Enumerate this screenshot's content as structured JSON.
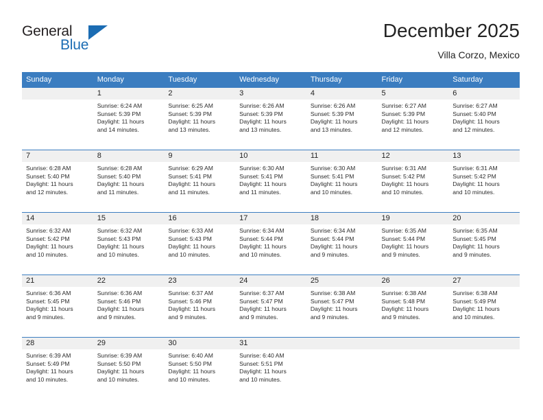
{
  "logo": {
    "line1": "General",
    "line2": "Blue",
    "triangle_icon": "triangle-icon",
    "color_primary": "#1b6cb3",
    "color_text": "#231f20"
  },
  "header": {
    "title": "December 2025",
    "subtitle": "Villa Corzo, Mexico"
  },
  "theme": {
    "header_bg": "#3b7dc0",
    "daynum_bg": "#f0f0f0",
    "text": "#232323"
  },
  "weekdays": [
    "Sunday",
    "Monday",
    "Tuesday",
    "Wednesday",
    "Thursday",
    "Friday",
    "Saturday"
  ],
  "weeks": [
    [
      {
        "day": "",
        "sunrise": "",
        "sunset": "",
        "daylight1": "",
        "daylight2": "",
        "empty": true
      },
      {
        "day": "1",
        "sunrise": "Sunrise: 6:24 AM",
        "sunset": "Sunset: 5:39 PM",
        "daylight1": "Daylight: 11 hours",
        "daylight2": "and 14 minutes."
      },
      {
        "day": "2",
        "sunrise": "Sunrise: 6:25 AM",
        "sunset": "Sunset: 5:39 PM",
        "daylight1": "Daylight: 11 hours",
        "daylight2": "and 13 minutes."
      },
      {
        "day": "3",
        "sunrise": "Sunrise: 6:26 AM",
        "sunset": "Sunset: 5:39 PM",
        "daylight1": "Daylight: 11 hours",
        "daylight2": "and 13 minutes."
      },
      {
        "day": "4",
        "sunrise": "Sunrise: 6:26 AM",
        "sunset": "Sunset: 5:39 PM",
        "daylight1": "Daylight: 11 hours",
        "daylight2": "and 13 minutes."
      },
      {
        "day": "5",
        "sunrise": "Sunrise: 6:27 AM",
        "sunset": "Sunset: 5:39 PM",
        "daylight1": "Daylight: 11 hours",
        "daylight2": "and 12 minutes."
      },
      {
        "day": "6",
        "sunrise": "Sunrise: 6:27 AM",
        "sunset": "Sunset: 5:40 PM",
        "daylight1": "Daylight: 11 hours",
        "daylight2": "and 12 minutes."
      }
    ],
    [
      {
        "day": "7",
        "sunrise": "Sunrise: 6:28 AM",
        "sunset": "Sunset: 5:40 PM",
        "daylight1": "Daylight: 11 hours",
        "daylight2": "and 12 minutes."
      },
      {
        "day": "8",
        "sunrise": "Sunrise: 6:28 AM",
        "sunset": "Sunset: 5:40 PM",
        "daylight1": "Daylight: 11 hours",
        "daylight2": "and 11 minutes."
      },
      {
        "day": "9",
        "sunrise": "Sunrise: 6:29 AM",
        "sunset": "Sunset: 5:41 PM",
        "daylight1": "Daylight: 11 hours",
        "daylight2": "and 11 minutes."
      },
      {
        "day": "10",
        "sunrise": "Sunrise: 6:30 AM",
        "sunset": "Sunset: 5:41 PM",
        "daylight1": "Daylight: 11 hours",
        "daylight2": "and 11 minutes."
      },
      {
        "day": "11",
        "sunrise": "Sunrise: 6:30 AM",
        "sunset": "Sunset: 5:41 PM",
        "daylight1": "Daylight: 11 hours",
        "daylight2": "and 10 minutes."
      },
      {
        "day": "12",
        "sunrise": "Sunrise: 6:31 AM",
        "sunset": "Sunset: 5:42 PM",
        "daylight1": "Daylight: 11 hours",
        "daylight2": "and 10 minutes."
      },
      {
        "day": "13",
        "sunrise": "Sunrise: 6:31 AM",
        "sunset": "Sunset: 5:42 PM",
        "daylight1": "Daylight: 11 hours",
        "daylight2": "and 10 minutes."
      }
    ],
    [
      {
        "day": "14",
        "sunrise": "Sunrise: 6:32 AM",
        "sunset": "Sunset: 5:42 PM",
        "daylight1": "Daylight: 11 hours",
        "daylight2": "and 10 minutes."
      },
      {
        "day": "15",
        "sunrise": "Sunrise: 6:32 AM",
        "sunset": "Sunset: 5:43 PM",
        "daylight1": "Daylight: 11 hours",
        "daylight2": "and 10 minutes."
      },
      {
        "day": "16",
        "sunrise": "Sunrise: 6:33 AM",
        "sunset": "Sunset: 5:43 PM",
        "daylight1": "Daylight: 11 hours",
        "daylight2": "and 10 minutes."
      },
      {
        "day": "17",
        "sunrise": "Sunrise: 6:34 AM",
        "sunset": "Sunset: 5:44 PM",
        "daylight1": "Daylight: 11 hours",
        "daylight2": "and 10 minutes."
      },
      {
        "day": "18",
        "sunrise": "Sunrise: 6:34 AM",
        "sunset": "Sunset: 5:44 PM",
        "daylight1": "Daylight: 11 hours",
        "daylight2": "and 9 minutes."
      },
      {
        "day": "19",
        "sunrise": "Sunrise: 6:35 AM",
        "sunset": "Sunset: 5:44 PM",
        "daylight1": "Daylight: 11 hours",
        "daylight2": "and 9 minutes."
      },
      {
        "day": "20",
        "sunrise": "Sunrise: 6:35 AM",
        "sunset": "Sunset: 5:45 PM",
        "daylight1": "Daylight: 11 hours",
        "daylight2": "and 9 minutes."
      }
    ],
    [
      {
        "day": "21",
        "sunrise": "Sunrise: 6:36 AM",
        "sunset": "Sunset: 5:45 PM",
        "daylight1": "Daylight: 11 hours",
        "daylight2": "and 9 minutes."
      },
      {
        "day": "22",
        "sunrise": "Sunrise: 6:36 AM",
        "sunset": "Sunset: 5:46 PM",
        "daylight1": "Daylight: 11 hours",
        "daylight2": "and 9 minutes."
      },
      {
        "day": "23",
        "sunrise": "Sunrise: 6:37 AM",
        "sunset": "Sunset: 5:46 PM",
        "daylight1": "Daylight: 11 hours",
        "daylight2": "and 9 minutes."
      },
      {
        "day": "24",
        "sunrise": "Sunrise: 6:37 AM",
        "sunset": "Sunset: 5:47 PM",
        "daylight1": "Daylight: 11 hours",
        "daylight2": "and 9 minutes."
      },
      {
        "day": "25",
        "sunrise": "Sunrise: 6:38 AM",
        "sunset": "Sunset: 5:47 PM",
        "daylight1": "Daylight: 11 hours",
        "daylight2": "and 9 minutes."
      },
      {
        "day": "26",
        "sunrise": "Sunrise: 6:38 AM",
        "sunset": "Sunset: 5:48 PM",
        "daylight1": "Daylight: 11 hours",
        "daylight2": "and 9 minutes."
      },
      {
        "day": "27",
        "sunrise": "Sunrise: 6:38 AM",
        "sunset": "Sunset: 5:49 PM",
        "daylight1": "Daylight: 11 hours",
        "daylight2": "and 10 minutes."
      }
    ],
    [
      {
        "day": "28",
        "sunrise": "Sunrise: 6:39 AM",
        "sunset": "Sunset: 5:49 PM",
        "daylight1": "Daylight: 11 hours",
        "daylight2": "and 10 minutes."
      },
      {
        "day": "29",
        "sunrise": "Sunrise: 6:39 AM",
        "sunset": "Sunset: 5:50 PM",
        "daylight1": "Daylight: 11 hours",
        "daylight2": "and 10 minutes."
      },
      {
        "day": "30",
        "sunrise": "Sunrise: 6:40 AM",
        "sunset": "Sunset: 5:50 PM",
        "daylight1": "Daylight: 11 hours",
        "daylight2": "and 10 minutes."
      },
      {
        "day": "31",
        "sunrise": "Sunrise: 6:40 AM",
        "sunset": "Sunset: 5:51 PM",
        "daylight1": "Daylight: 11 hours",
        "daylight2": "and 10 minutes."
      },
      {
        "day": "",
        "sunrise": "",
        "sunset": "",
        "daylight1": "",
        "daylight2": "",
        "empty": true
      },
      {
        "day": "",
        "sunrise": "",
        "sunset": "",
        "daylight1": "",
        "daylight2": "",
        "empty": true
      },
      {
        "day": "",
        "sunrise": "",
        "sunset": "",
        "daylight1": "",
        "daylight2": "",
        "empty": true
      }
    ]
  ]
}
